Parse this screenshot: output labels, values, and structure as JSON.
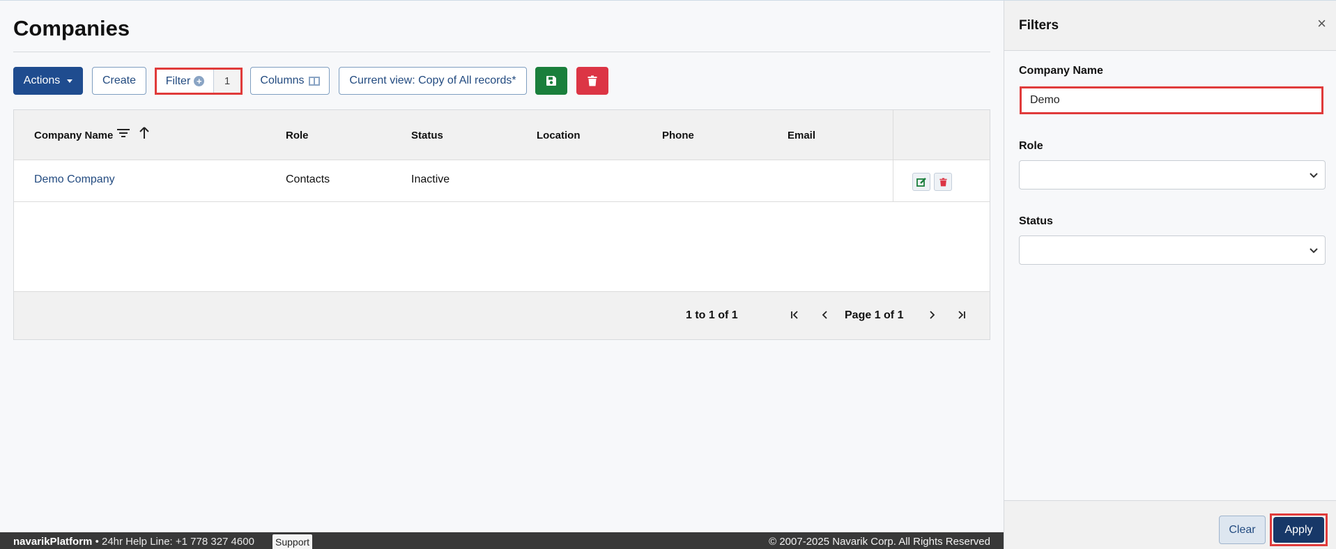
{
  "page": {
    "title": "Companies"
  },
  "toolbar": {
    "actions_label": "Actions",
    "create_label": "Create",
    "filter_label": "Filter",
    "filter_count": "1",
    "columns_label": "Columns",
    "view_label": "Current view: Copy of All records*"
  },
  "table": {
    "columns": [
      "Company Name",
      "Role",
      "Status",
      "Location",
      "Phone",
      "Email"
    ],
    "rows": [
      {
        "company_name": "Demo Company",
        "role": "Contacts",
        "status": "Inactive",
        "location": "",
        "phone": "",
        "email": ""
      }
    ],
    "range_text": "1 to 1 of 1",
    "page_text": "Page 1 of 1"
  },
  "footer": {
    "brand": "navarikPlatform",
    "helpline": "• 24hr Help Line: +1 778 327 4600",
    "support_label": "Support",
    "copyright": "© 2007-2025 Navarik Corp. All Rights Reserved"
  },
  "filters_panel": {
    "title": "Filters",
    "company_name_label": "Company Name",
    "company_name_value": "Demo",
    "role_label": "Role",
    "role_value": "",
    "status_label": "Status",
    "status_value": "",
    "clear_label": "Clear",
    "apply_label": "Apply"
  },
  "colors": {
    "primary": "#1f4c8f",
    "save_green": "#1a7f3c",
    "delete_red": "#dc3545",
    "highlight_red": "#e03b3b",
    "apply_navy": "#173868"
  }
}
